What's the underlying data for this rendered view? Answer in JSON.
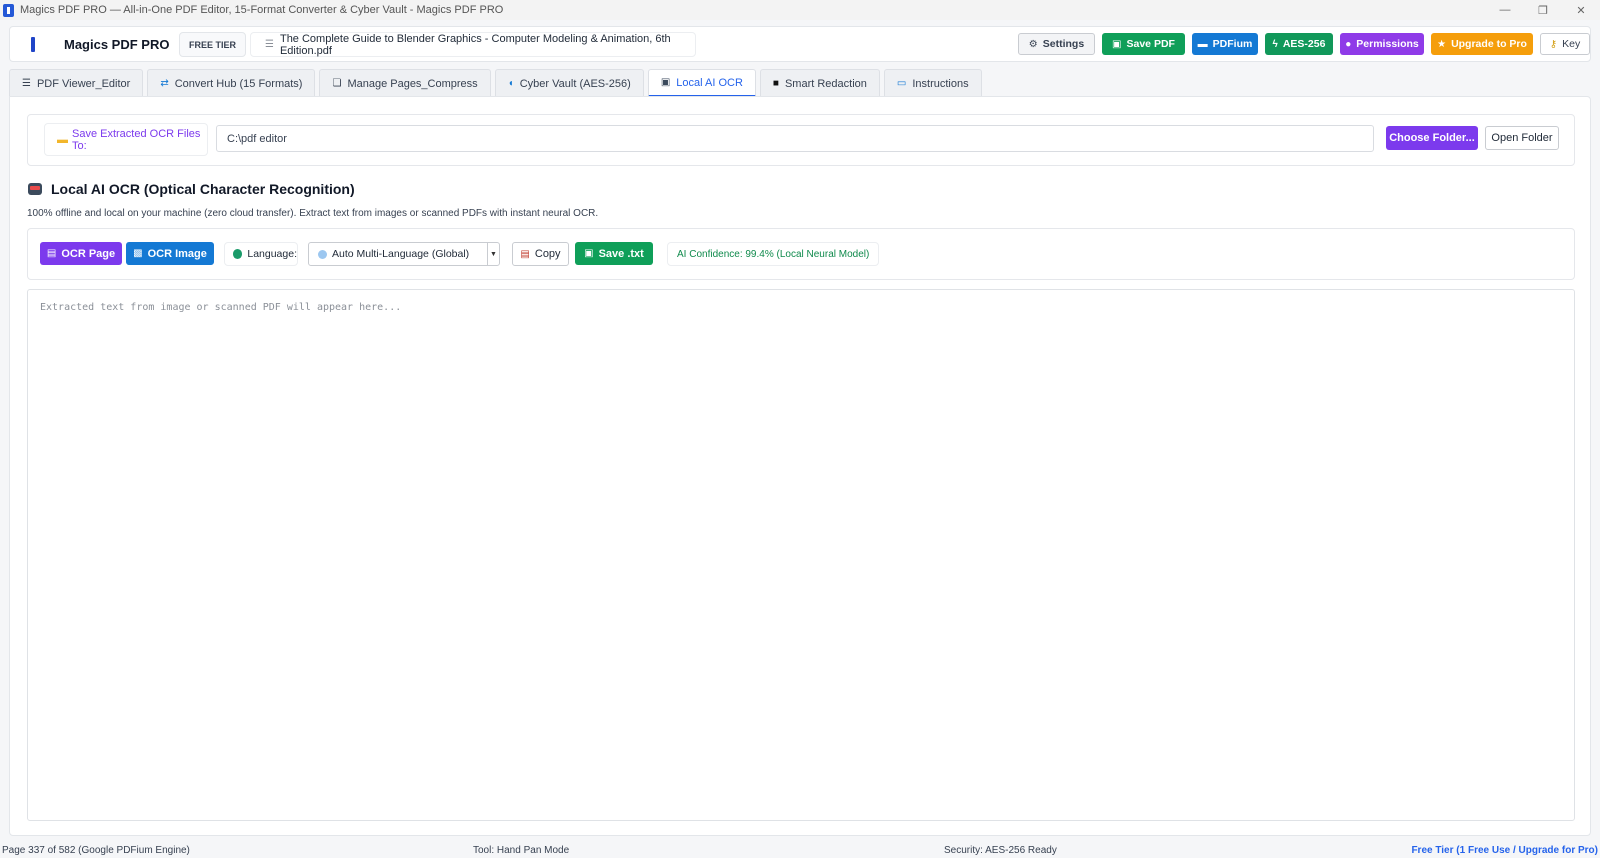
{
  "window": {
    "title": "Magics PDF PRO — All-in-One PDF Editor, 15-Format Converter & Cyber Vault - Magics PDF PRO",
    "controls": {
      "minimize": "—",
      "restore": "❐",
      "close": "✕"
    }
  },
  "header": {
    "brand": "Magics PDF PRO",
    "tier_badge": "FREE TIER",
    "file_name": "The Complete Guide to Blender Graphics - Computer Modeling & Animation, 6th Edition.pdf",
    "buttons": {
      "settings": "Settings",
      "save_pdf": "Save PDF",
      "pdfium": "PDFium",
      "aes": "AES-256",
      "permissions": "Permissions",
      "upgrade": "Upgrade to Pro",
      "key": "Key"
    }
  },
  "tabs": [
    {
      "label": "PDF Viewer_Editor",
      "icon": "document-icon"
    },
    {
      "label": "Convert Hub (15 Formats)",
      "icon": "convert-icon"
    },
    {
      "label": "Manage Pages_Compress",
      "icon": "pages-icon"
    },
    {
      "label": "Cyber Vault (AES-256)",
      "icon": "shield-icon"
    },
    {
      "label": "Local AI OCR",
      "icon": "robot-icon",
      "active": true
    },
    {
      "label": "Smart Redaction",
      "icon": "redaction-icon"
    },
    {
      "label": "Instructions",
      "icon": "book-icon"
    }
  ],
  "ocr": {
    "save_label": "Save Extracted OCR Files To:",
    "path_value": "C:\\pdf editor",
    "choose_folder": "Choose Folder...",
    "open_folder": "Open Folder",
    "title": "Local AI OCR (Optical Character Recognition)",
    "description": "100% offline and local on your machine (zero cloud transfer). Extract text from images or scanned PDFs with instant neural OCR.",
    "ocr_page": "OCR Page",
    "ocr_image": "OCR Image",
    "language_label": "Language:",
    "language_value": "Auto Multi-Language (Global)",
    "copy": "Copy",
    "save_txt": "Save .txt",
    "confidence": "AI Confidence: 99.4% (Local Neural Model)",
    "output_placeholder": "Extracted text from image or scanned PDF will appear here..."
  },
  "status": {
    "page": "Page 337 of 582 (Google PDFium Engine)",
    "tool": "Tool: Hand Pan Mode",
    "security": "Security: AES-256 Ready",
    "tier": "Free Tier (1 Free Use / Upgrade for Pro)"
  },
  "colors": {
    "accent_purple": "#7c3aed",
    "accent_blue": "#1479d4",
    "accent_green": "#0f9f59",
    "accent_orange": "#f59e0b",
    "active_tab": "#2563eb"
  }
}
